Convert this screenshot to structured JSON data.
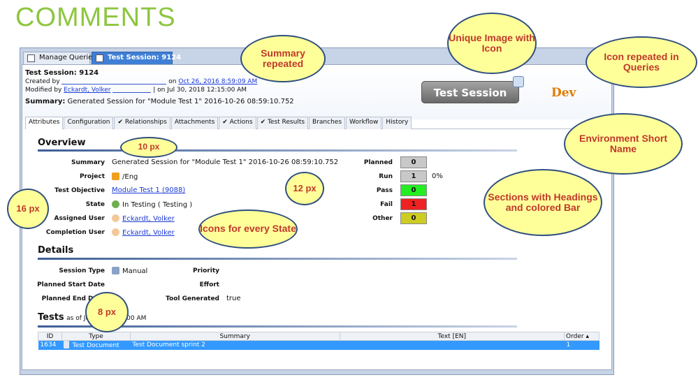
{
  "slide": {
    "title": "COMMENTS"
  },
  "window_tabs": [
    {
      "label": "Manage Queries",
      "close": "✕"
    },
    {
      "label": "Test Session: 9124"
    }
  ],
  "header": {
    "title": "Test Session:  9124",
    "created_by_label": "Created by",
    "created_on_prefix": "on",
    "created_on": "Oct 26, 2016 8:59:09 AM",
    "modified_by_label": "Modified by",
    "modified_by": "Eckardt, Volker",
    "modified_on": "| on Jul 30, 2018 12:15:00 AM",
    "summary_label": "Summary:",
    "summary": "Generated Session for \"Module Test 1\" 2016-10-26 08:59:10.752",
    "type_image_label": "Test Session",
    "env_short": "Dev"
  },
  "inner_tabs": [
    "Attributes",
    "Configuration",
    "✔ Relationships",
    "Attachments",
    "✔ Actions",
    "✔ Test Results",
    "Branches",
    "Workflow",
    "History"
  ],
  "overview": {
    "heading": "Overview",
    "summary_label": "Summary",
    "summary_value": "Generated Session for \"Module Test 1\" 2016-10-26 08:59:10.752",
    "project_label": "Project",
    "project_value": "/Eng",
    "objective_label": "Test Objective",
    "objective_value": "Module Test 1 (9088)",
    "state_label": "State",
    "state_value": "In Testing  ( Testing )",
    "assigned_label": "Assigned User",
    "assigned_value": "Eckardt, Volker",
    "completion_label": "Completion User",
    "completion_value": "Eckardt, Volker",
    "stats": [
      {
        "label": "Planned",
        "value": "0",
        "color": "#c8c8c8"
      },
      {
        "label": "Run",
        "value": "1",
        "color": "#c8c8c8",
        "pct": "0%"
      },
      {
        "label": "Pass",
        "value": "0",
        "color": "#22ee22"
      },
      {
        "label": "Fail",
        "value": "1",
        "color": "#ee2222"
      },
      {
        "label": "Other",
        "value": "0",
        "color": "#cccc22"
      }
    ]
  },
  "details": {
    "heading": "Details",
    "session_type_label": "Session Type",
    "session_type_value": "Manual",
    "priority_label": "Priority",
    "planned_start_label": "Planned Start Date",
    "effort_label": "Effort",
    "planned_end_label": "Planned End Date",
    "tool_generated_label": "Tool Generated",
    "tool_generated_value": "true"
  },
  "tests": {
    "heading": "Tests",
    "as_of": "as of Ju",
    "as_of_tail": ":15:00 AM",
    "columns": [
      "ID",
      "Type",
      "Summary",
      "Text [EN]",
      "Order ▴"
    ],
    "rows": [
      {
        "id": "1634",
        "type": "Test Document",
        "summary": "Test Document sprint 2",
        "text": "",
        "order": "1"
      }
    ]
  },
  "callouts": {
    "summary_repeated": "Summary repeated",
    "unique_image": "Unique Image with Icon",
    "icon_repeated": "Icon repeated in Queries",
    "env_name": "Environment Short Name",
    "sections": "Sections with Headings and colored Bar",
    "ten_px": "10 px",
    "twelve_px": "12 px",
    "sixteen_px": "16 px",
    "icons_state": "Icons for every State",
    "eight_px": "8 px"
  }
}
